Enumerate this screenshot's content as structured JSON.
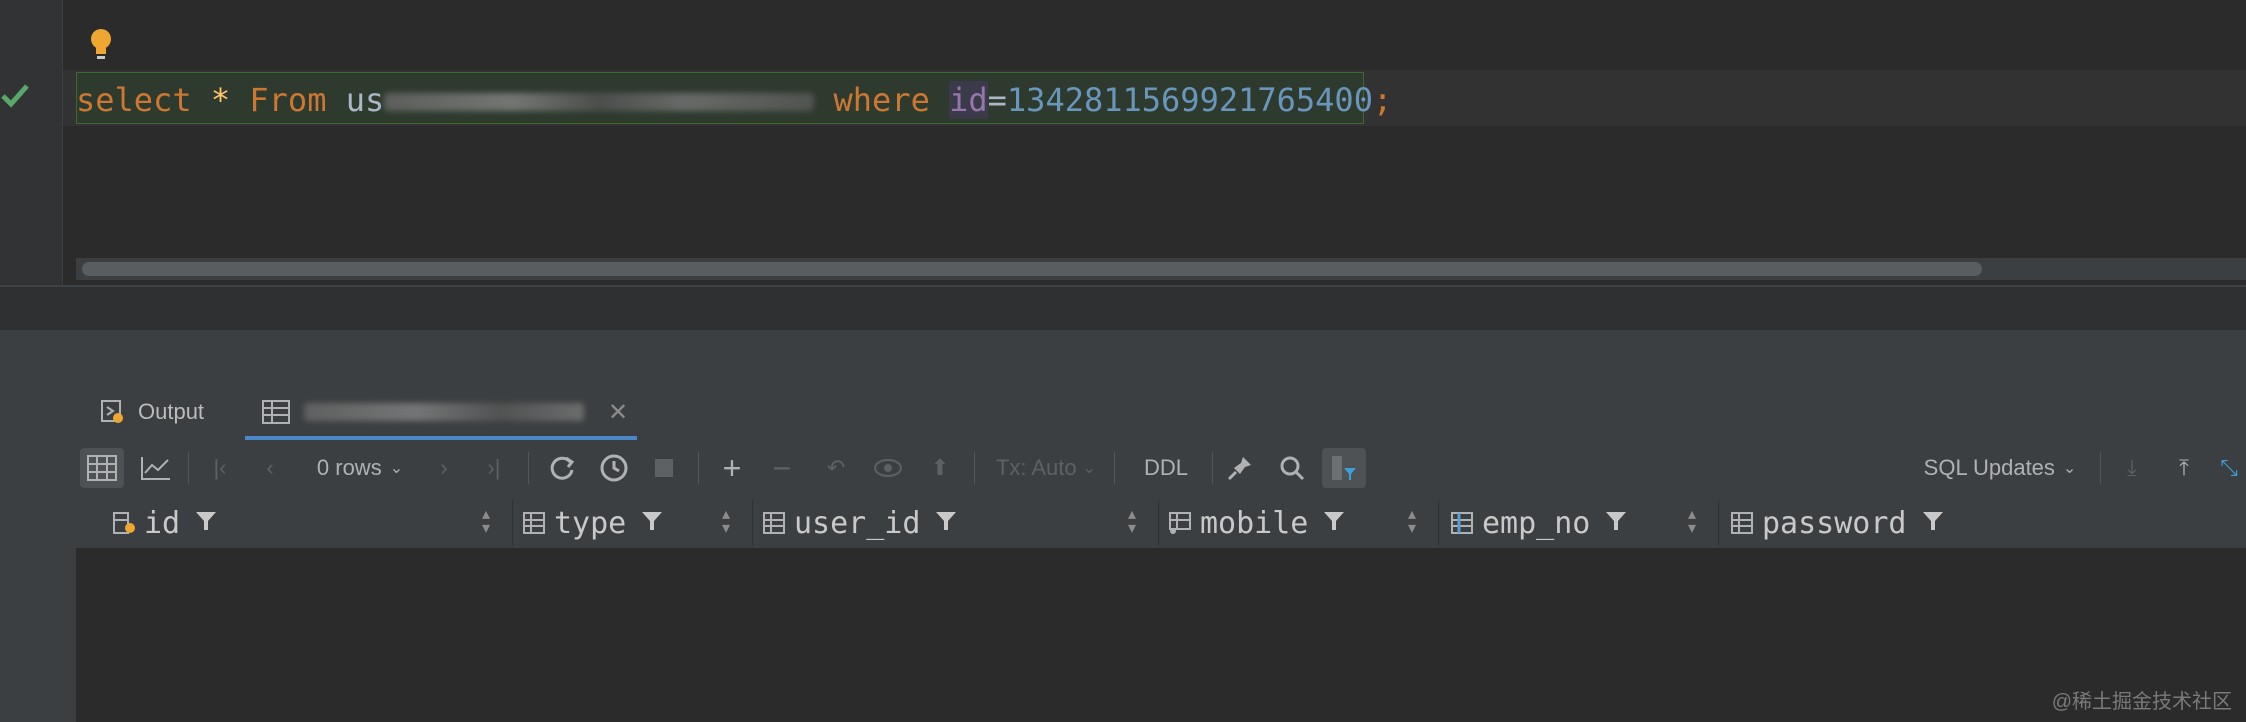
{
  "editor": {
    "keyword_select": "select",
    "star": "*",
    "keyword_from": "From",
    "table_prefix": "us",
    "keyword_where": "where",
    "column": "id",
    "equals": "=",
    "value": "1342811569921765400",
    "semicolon": ";"
  },
  "tabs": {
    "output_label": "Output"
  },
  "toolbar": {
    "rows_label": "0 rows",
    "tx_label": "Tx: Auto",
    "ddl_label": "DDL",
    "sql_updates_label": "SQL Updates"
  },
  "columns": [
    {
      "name": "id"
    },
    {
      "name": "type"
    },
    {
      "name": "user_id"
    },
    {
      "name": "mobile"
    },
    {
      "name": "emp_no"
    },
    {
      "name": "password"
    }
  ],
  "watermark": "@稀土掘金技术社区",
  "colors": {
    "keyword": "#cc7832",
    "number": "#6897bb",
    "column": "#9876aa",
    "accent": "#4a88c7",
    "success": "#59a869"
  }
}
